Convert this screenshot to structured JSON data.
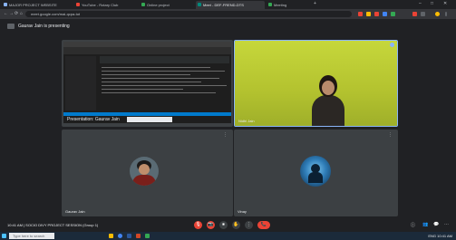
{
  "browser": {
    "tabs": [
      {
        "label": "MAJOR PROJECT WEBSITE",
        "color": "#8ab4f8"
      },
      {
        "label": "YouTube - Rotary Club",
        "color": "#ea4335"
      },
      {
        "label": "Online project",
        "color": "#34a853"
      },
      {
        "label": "Meet - DEF-FREND-DTS",
        "color": "#00897b"
      },
      {
        "label": "Meeting",
        "color": "#34a853"
      }
    ],
    "new_tab": "+",
    "window_controls": [
      "–",
      "□",
      "✕"
    ],
    "address": "meet.google.com/mai-qcpa-tot",
    "nav": [
      "←",
      "→",
      "⟳",
      "⌂"
    ]
  },
  "banner": {
    "message": "Gaurav Jain is presenting"
  },
  "tiles": {
    "presenter": {
      "name": "Presentation: Gaurav Jain"
    },
    "webcam": {
      "name": "Nidhi Jain"
    },
    "participant_one": {
      "name": "Gaurav Jain"
    },
    "participant_two": {
      "name": "Vinay"
    }
  },
  "bottom": {
    "meeting_info": "10:41 AM  |  SOCIO DIVY PROJECT SESSION (Group 1)",
    "controls": [
      "🎙",
      "📷",
      "⏹",
      "✋",
      "⋮",
      "📞"
    ],
    "right": [
      "ⓘ",
      "👥",
      "💬",
      "⋯"
    ]
  },
  "taskbar": {
    "search_placeholder": "Type here to search",
    "tray": "ENG  10:41 AM"
  },
  "colors": {
    "red_control": "#ea4335",
    "hangup": "#ea4335",
    "presenting_border": "#8ab4f8"
  }
}
